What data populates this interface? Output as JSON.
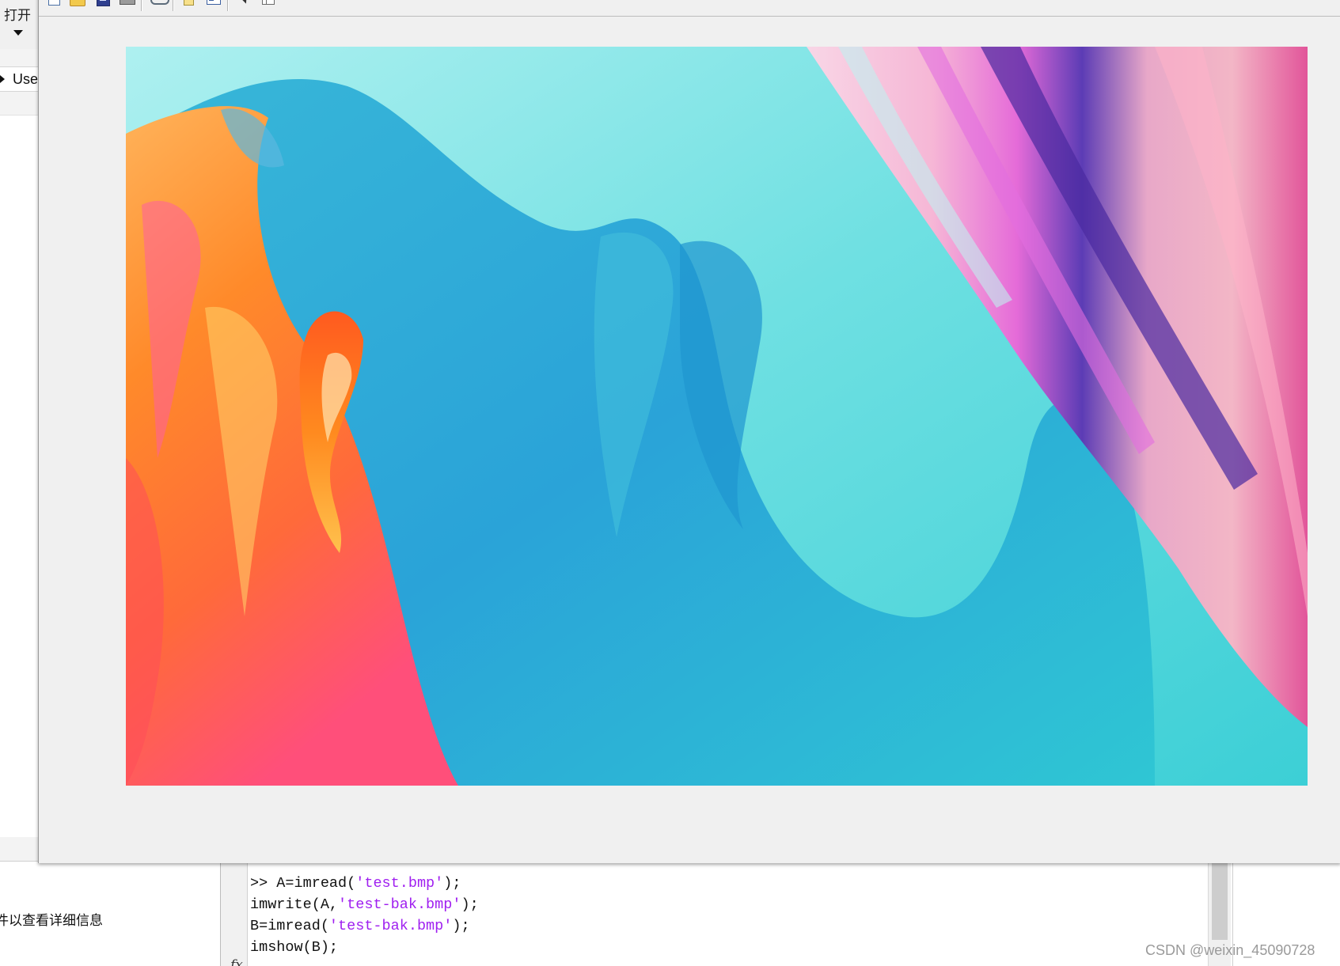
{
  "app": {
    "open_button_label": "打开",
    "current_folder_text": "Use"
  },
  "details_panel": {
    "hint_text": "件以查看详细信息"
  },
  "figure": {
    "toolbar": [
      {
        "name": "new-figure-icon"
      },
      {
        "name": "open-file-icon"
      },
      {
        "name": "save-figure-icon"
      },
      {
        "name": "print-figure-icon"
      },
      {
        "name": "link-plot-icon"
      },
      {
        "name": "insert-colorbar-icon"
      },
      {
        "name": "insert-legend-icon"
      },
      {
        "name": "edit-plot-cursor-icon"
      },
      {
        "name": "property-inspector-icon"
      }
    ],
    "image": {
      "description_colors": {
        "background": "#5fd8da",
        "wave_blue": "#2a9fd6",
        "warm_orange": "#ff8a1f",
        "pink": "#ff5fa0",
        "purple": "#5b2fb0"
      }
    }
  },
  "command_window": {
    "lines": [
      [
        {
          "text": ">> A=imread(",
          "type": "code"
        },
        {
          "text": "'test.bmp'",
          "type": "string"
        },
        {
          "text": ");",
          "type": "code"
        }
      ],
      [
        {
          "text": "imwrite(A,",
          "type": "code"
        },
        {
          "text": "'test-bak.bmp'",
          "type": "string"
        },
        {
          "text": ");",
          "type": "code"
        }
      ],
      [
        {
          "text": "B=imread(",
          "type": "code"
        },
        {
          "text": "'test-bak.bmp'",
          "type": "string"
        },
        {
          "text": ");",
          "type": "code"
        }
      ],
      [
        {
          "text": "imshow(B);",
          "type": "code"
        }
      ]
    ],
    "prompt_icon": "fx"
  },
  "watermark": "CSDN @weixin_45090728"
}
